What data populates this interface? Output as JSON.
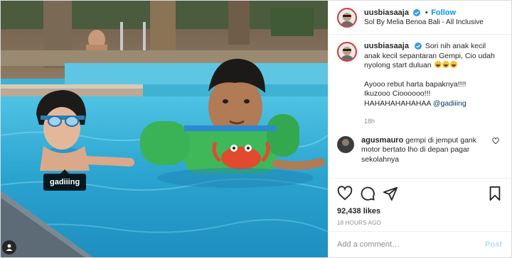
{
  "photo": {
    "tag_label": "gadiiing"
  },
  "header": {
    "username": "uusbiasaaja",
    "separator": "•",
    "follow_label": "Follow",
    "location": "Sol By Melia Benoa Bali - All Inclusive"
  },
  "caption": {
    "username": "uusbiasaaja",
    "line1": "Sori nih anak kecil anak kecil sepantaran Gempi, Cio udah nyolong start duluan",
    "emoji_count": 3,
    "line2": "Ayooo rebut harta bapaknya!!!!",
    "line3": "Ikuzooo Cioooooo!!!",
    "line4_text": "HAHAHAHAHAHAA ",
    "line4_mention": "@gadiiing",
    "time": "18h"
  },
  "reply": {
    "username": "agusmauro",
    "text": "gempi di jemput gank motor bertato lho di depan pagar sekolahnya"
  },
  "stats": {
    "likes": "92,438 likes",
    "posted": "18 HOURS AGO"
  },
  "comment_box": {
    "placeholder": "Add a comment…",
    "post_label": "Post"
  },
  "colors": {
    "accent": "#0095f6",
    "verified": "#3897f0",
    "pool": "#3fb2d4"
  },
  "icons": [
    "verified-badge-icon",
    "heart-icon",
    "comment-icon",
    "share-icon",
    "bookmark-icon",
    "user-tag-icon",
    "emoji-icon"
  ]
}
